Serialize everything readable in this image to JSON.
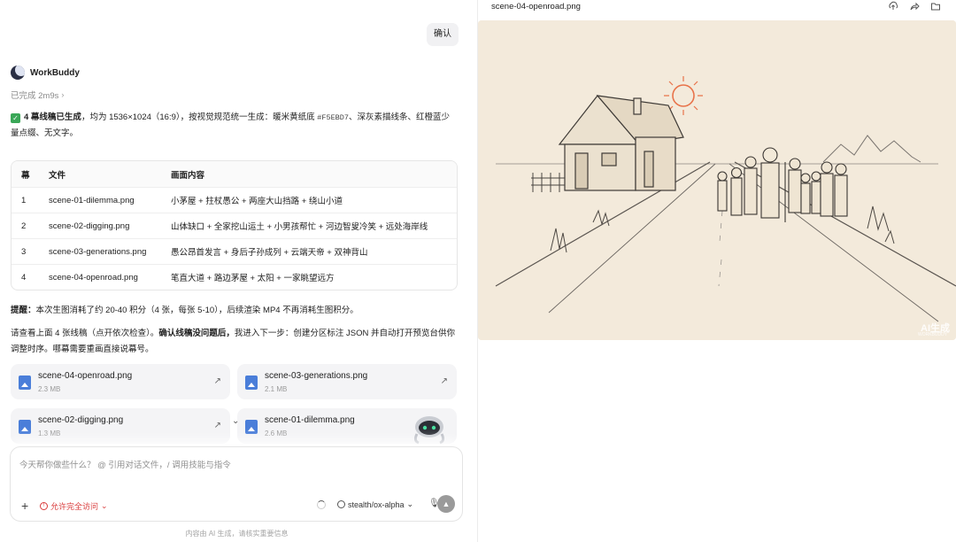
{
  "chat": {
    "user_message": "确认",
    "agent_name": "WorkBuddy",
    "status_text": "已完成 2m9s",
    "summary": {
      "bold": "4 幕线稿已生成",
      "text_a": "，均为 1536×1024（16:9），按视觉规范统一生成：暖米黄纸底 ",
      "code": "#F5EBD7",
      "text_b": "、深灰素描线条、红橙蓝少量点缀、无文字。"
    },
    "table": {
      "headers": [
        "幕",
        "文件",
        "画面内容"
      ],
      "rows": [
        {
          "num": "1",
          "file": "scene-01-dilemma.png",
          "content": "小茅屋 + 拄杖愚公 + 两座大山挡路 + 绕山小道"
        },
        {
          "num": "2",
          "file": "scene-02-digging.png",
          "content": "山体缺口 + 全家挖山运土 + 小男孩帮忙 + 河边智叟冷笑 + 远处海岸线"
        },
        {
          "num": "3",
          "file": "scene-03-generations.png",
          "content": "愚公昂首发言 + 身后子孙成列 + 云端天帝 + 双神背山"
        },
        {
          "num": "4",
          "file": "scene-04-openroad.png",
          "content": "笔直大道 + 路边茅屋 + 太阳 + 一家眺望远方"
        }
      ]
    },
    "reminder": {
      "bold": "提醒：",
      "text": "本次生图消耗了约 20-40 积分（4 张，每张 5-10），后续渲染 MP4 不再消耗生图积分。"
    },
    "review": {
      "text_a": "请查看上面 4 张线稿（点开依次检查）。",
      "bold": "确认线稿没问题后，",
      "text_b": "我进入下一步：创建分区标注 JSON 并自动打开预览台供你调整时序。哪幕需要重画直接说幕号。"
    },
    "files": [
      {
        "name": "scene-04-openroad.png",
        "size": "2.3 MB"
      },
      {
        "name": "scene-03-generations.png",
        "size": "2.1 MB"
      },
      {
        "name": "scene-02-digging.png",
        "size": "1.3 MB"
      },
      {
        "name": "scene-01-dilemma.png",
        "size": "2.6 MB"
      }
    ]
  },
  "composer": {
    "placeholder": "今天帮你做些什么？ @ 引用对话文件，/ 调用技能与指令",
    "permission_label": "允许完全访问",
    "model_label": "stealth/ox-alpha",
    "footer_note": "内容由 AI 生成，请核实重要信息"
  },
  "preview": {
    "title": "scene-04-openroad.png",
    "watermark": "AI生成",
    "watermark_sub": "WORKBUDDY"
  },
  "colors": {
    "paper": "#F5EBD7",
    "sun": "#E8734A",
    "accent_red": "#d93a3a",
    "file_icon": "#4a7ed9"
  },
  "icons": [
    "upload-icon",
    "share-icon",
    "folder-icon",
    "image-file-icon",
    "open-arrow-icon",
    "plus-icon",
    "warning-icon",
    "globe-icon",
    "mic-icon",
    "send-icon",
    "chevron-right-icon",
    "chevron-down-icon"
  ]
}
